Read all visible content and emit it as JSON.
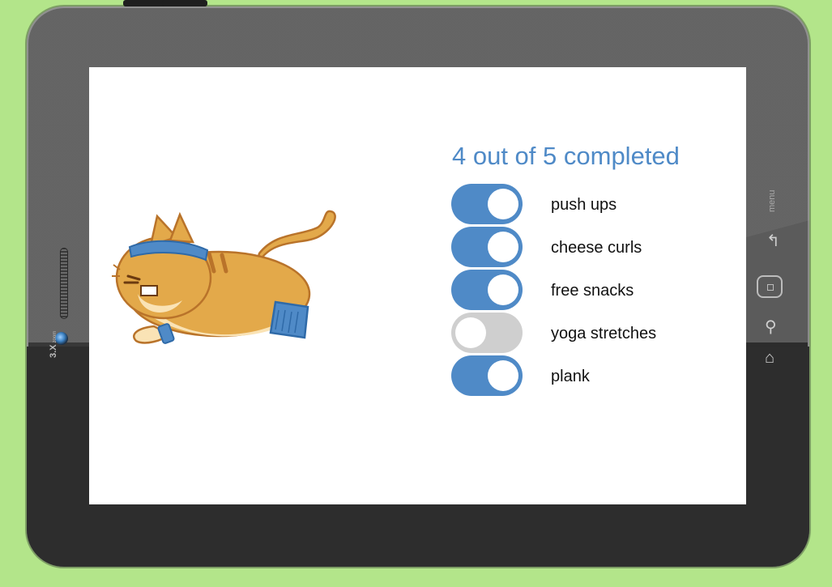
{
  "device": {
    "zoom_label": "3.X",
    "zoom_sub": "zoom",
    "menu_label": "menu"
  },
  "heading": "4 out of 5 completed",
  "tasks": [
    {
      "label": "push ups",
      "done": true
    },
    {
      "label": "cheese curls",
      "done": true
    },
    {
      "label": "free snacks",
      "done": true
    },
    {
      "label": "yoga stretches",
      "done": false
    },
    {
      "label": "plank",
      "done": true
    }
  ],
  "colors": {
    "accent": "#4f8ac7",
    "toggle_off": "#cfcfcf",
    "background": "#b3e58a"
  },
  "illustration": {
    "name": "cat-exercising",
    "headband_color": "#4f8ac7",
    "fur_color": "#d9992e"
  }
}
